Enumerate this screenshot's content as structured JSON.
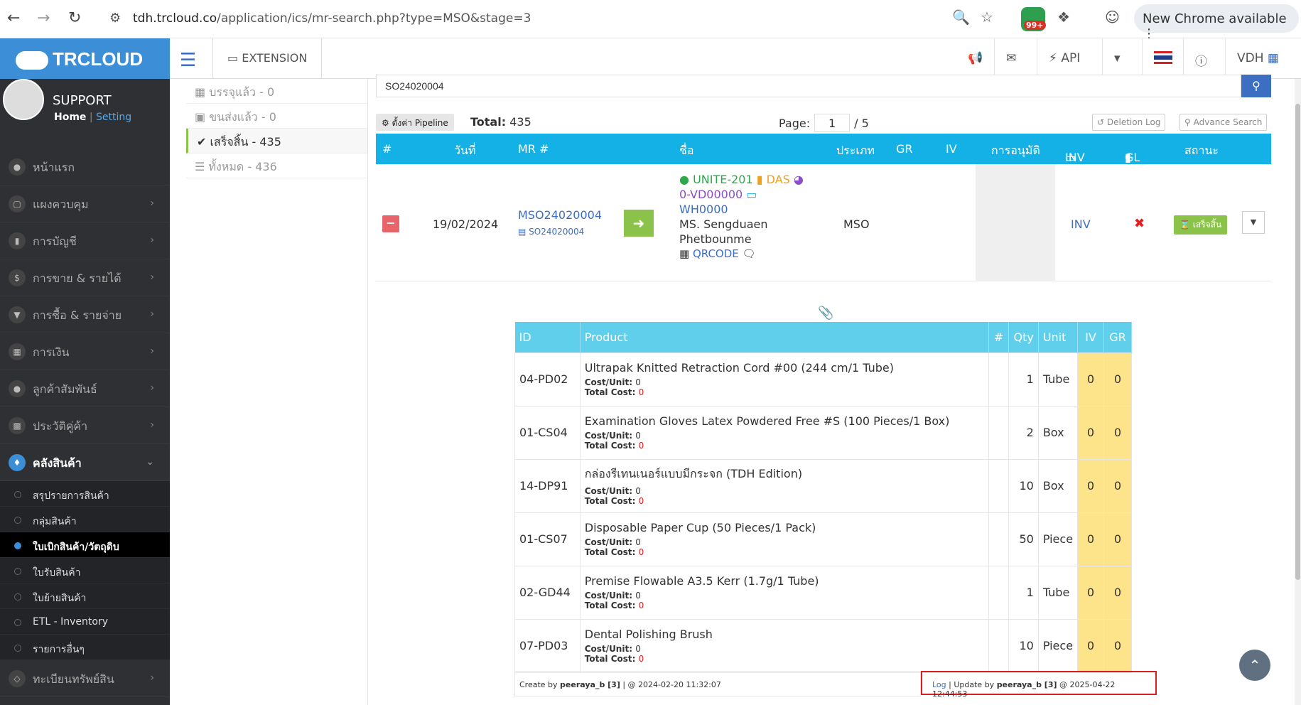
{
  "browser": {
    "url_host": "tdh.trcloud.co",
    "url_path": "/application/ics/mr-search.php?type=MSO&stage=3",
    "ext_badge": "99+",
    "new_chrome": "New Chrome available"
  },
  "sidebar": {
    "brand": "TRCLOUD",
    "user": "SUPPORT",
    "home": "Home",
    "setting": "Setting",
    "items": [
      {
        "label": "หน้าแรก",
        "icon": "dashboard-icon"
      },
      {
        "label": "แผงควบคุม",
        "icon": "monitor-icon"
      },
      {
        "label": "การบัญชี",
        "icon": "book-icon"
      },
      {
        "label": "การขาย & รายได้",
        "icon": "dollar-icon"
      },
      {
        "label": "การซื้อ & รายจ่าย",
        "icon": "cart-icon"
      },
      {
        "label": "การเงิน",
        "icon": "calendar-icon"
      },
      {
        "label": "ลูกค้าสัมพันธ์",
        "icon": "users-icon"
      },
      {
        "label": "ประวัติคู่ค้า",
        "icon": "contact-icon"
      }
    ],
    "active": {
      "label": "คลังสินค้า",
      "icon": "warehouse-icon"
    },
    "sub": [
      "สรุปรายการสินค้า",
      "กลุ่มสินค้า",
      "ใบเบิกสินค้า/วัตถุดิบ",
      "ใบรับสินค้า",
      "ใบย้ายสินค้า",
      "ETL - Inventory",
      "รายการอื่นๆ"
    ],
    "last": {
      "label": "ทะเบียนทรัพย์สิน",
      "icon": "diamond-icon"
    }
  },
  "topbar": {
    "extension": "EXTENSION",
    "api": "API",
    "user": "VDH"
  },
  "stages": [
    {
      "label": "บรรจุแล้ว - 0"
    },
    {
      "label": "ขนส่งแล้ว - 0"
    },
    {
      "label": "เสร็จสิ้น - 435"
    },
    {
      "label": "ทั้งหมด - 436"
    }
  ],
  "search": {
    "value": "SO24020004"
  },
  "toolbar": {
    "pipeline": "ตั้งค่า Pipeline",
    "total_label": "Total:",
    "total": "435",
    "page_label": "Page:",
    "page": "1",
    "pages": "/ 5",
    "deletion_log": "Deletion Log",
    "advance_search": "Advance Search"
  },
  "table_head": [
    "#",
    "วันที่",
    "MR #",
    "ชื่อ",
    "ประเภท",
    "GR",
    "IV",
    "การอนุมัติ",
    "INV",
    "GL",
    "สถานะ"
  ],
  "record": {
    "date": "19/02/2024",
    "mr": "MSO24020004",
    "so": "SO24020004",
    "unit": "UNITE-201",
    "das": "DAS",
    "vendor": "0-VD00000",
    "warehouse": "WH0000",
    "name1": "MS. Sengduaen",
    "name2": "Phetbounme",
    "qrcode": "QRCODE",
    "type": "MSO",
    "inv": "INV",
    "status": "เสร็จสิ้น"
  },
  "detail_head": [
    "ID",
    "Product",
    "#",
    "Qty",
    "Unit",
    "IV",
    "GR"
  ],
  "detail_labels": {
    "cost_unit": "Cost/Unit:",
    "total_cost": "Total Cost:"
  },
  "products": [
    {
      "id": "04-PD02",
      "name": "Ultrapak Knitted Retraction Cord #00 (244 cm/1 Tube)",
      "cost": "0",
      "total": "0",
      "qty": "1",
      "unit": "Tube",
      "iv": "0",
      "gr": "0"
    },
    {
      "id": "01-CS04",
      "name": "Examination Gloves Latex Powdered Free #S (100 Pieces/1 Box)",
      "cost": "0",
      "total": "0",
      "qty": "2",
      "unit": "Box",
      "iv": "0",
      "gr": "0"
    },
    {
      "id": "14-DP91",
      "name": "กล่องรีเทนเนอร์แบบมีกระจก  (TDH Edition)",
      "cost": "0",
      "total": "0",
      "qty": "10",
      "unit": "Box",
      "iv": "0",
      "gr": "0"
    },
    {
      "id": "01-CS07",
      "name": "Disposable Paper Cup (50 Pieces/1 Pack)",
      "cost": "0",
      "total": "0",
      "qty": "50",
      "unit": "Piece",
      "iv": "0",
      "gr": "0"
    },
    {
      "id": "02-GD44",
      "name": "Premise Flowable A3.5 Kerr (1.7g/1 Tube)",
      "cost": "0",
      "total": "0",
      "qty": "1",
      "unit": "Tube",
      "iv": "0",
      "gr": "0"
    },
    {
      "id": "07-PD03",
      "name": "Dental Polishing Brush",
      "cost": "0",
      "total": "0",
      "qty": "10",
      "unit": "Piece",
      "iv": "0",
      "gr": "0"
    }
  ],
  "footer": {
    "create_prefix": "Create by",
    "create_user": "peeraya_b [3]",
    "create_time": "| @ 2024-02-20 11:32:07",
    "log": "Log",
    "update_prefix": "| Update by",
    "update_user": "peeraya_b [3]",
    "update_time": "@ 2025-04-22 12:44:53"
  }
}
